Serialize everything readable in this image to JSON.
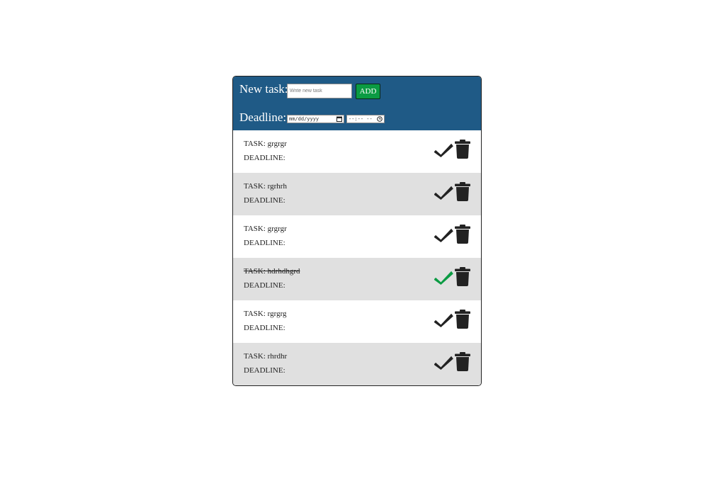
{
  "header": {
    "new_task_label": "New task:",
    "task_input": {
      "placeholder": "Write new task",
      "value": ""
    },
    "add_label": "ADD",
    "deadline_label": "Deadline:",
    "date_placeholder": "mm/dd/yyyy",
    "time_placeholder": "--:-- --"
  },
  "colors": {
    "header_bg": "#1f5a86",
    "add_button": "#0b9b43",
    "check_done": "#0b9b43",
    "check_default": "#222222",
    "row_alt": "#e0e0e0"
  },
  "tasks": [
    {
      "name": "TASK: grgrgr",
      "deadline": "DEADLINE:",
      "done": false
    },
    {
      "name": "TASK: rgrhrh",
      "deadline": "DEADLINE:",
      "done": false
    },
    {
      "name": "TASK: grgrgr",
      "deadline": "DEADLINE:",
      "done": false
    },
    {
      "name": "TASK: hdrhdhgrd",
      "deadline": "DEADLINE:",
      "done": true
    },
    {
      "name": "TASK: rgrgrg",
      "deadline": "DEADLINE:",
      "done": false
    },
    {
      "name": "TASK: rhrdhr",
      "deadline": "DEADLINE:",
      "done": false
    }
  ],
  "icons": {
    "complete": "check-icon",
    "delete": "trash-icon",
    "calendar": "calendar-icon",
    "clock": "clock-icon"
  }
}
